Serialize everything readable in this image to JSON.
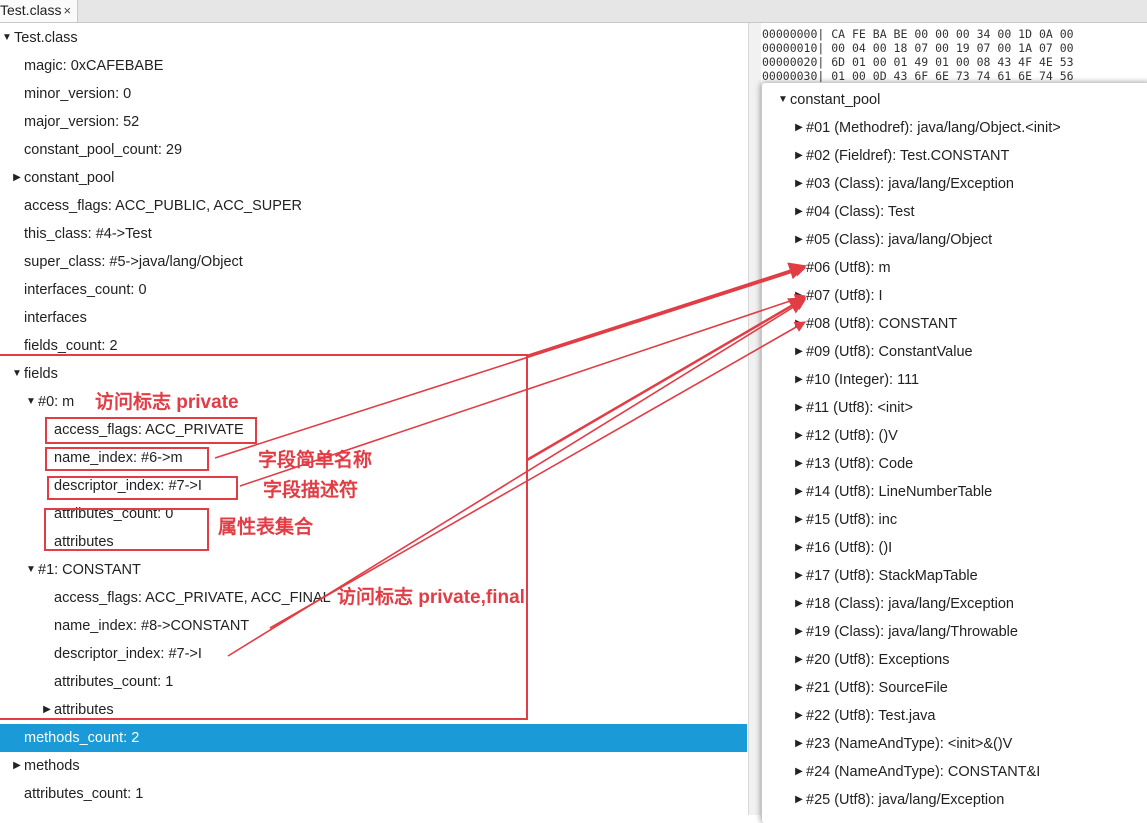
{
  "tab": {
    "label": "Test.class",
    "close": "×"
  },
  "tree": [
    {
      "depth": 0,
      "toggle": "open",
      "text": "Test.class"
    },
    {
      "depth": 1,
      "toggle": "none",
      "text": "magic: 0xCAFEBABE"
    },
    {
      "depth": 1,
      "toggle": "none",
      "text": "minor_version: 0"
    },
    {
      "depth": 1,
      "toggle": "none",
      "text": "major_version: 52"
    },
    {
      "depth": 1,
      "toggle": "none",
      "text": "constant_pool_count: 29"
    },
    {
      "depth": 1,
      "toggle": "closed",
      "text": "constant_pool"
    },
    {
      "depth": 1,
      "toggle": "none",
      "text": "access_flags: ACC_PUBLIC, ACC_SUPER"
    },
    {
      "depth": 1,
      "toggle": "none",
      "text": "this_class: #4->Test"
    },
    {
      "depth": 1,
      "toggle": "none",
      "text": "super_class: #5->java/lang/Object"
    },
    {
      "depth": 1,
      "toggle": "none",
      "text": "interfaces_count: 0"
    },
    {
      "depth": 1,
      "toggle": "none",
      "text": "interfaces"
    },
    {
      "depth": 1,
      "toggle": "none",
      "text": "fields_count: 2"
    },
    {
      "depth": 1,
      "toggle": "open",
      "text": "fields"
    },
    {
      "depth": 2,
      "toggle": "open",
      "text": "#0: m"
    },
    {
      "depth": 3,
      "toggle": "none",
      "text": "access_flags: ACC_PRIVATE"
    },
    {
      "depth": 3,
      "toggle": "none",
      "text": "name_index: #6->m"
    },
    {
      "depth": 3,
      "toggle": "none",
      "text": "descriptor_index: #7->I"
    },
    {
      "depth": 3,
      "toggle": "none",
      "text": "attributes_count: 0"
    },
    {
      "depth": 3,
      "toggle": "none",
      "text": "attributes"
    },
    {
      "depth": 2,
      "toggle": "open",
      "text": "#1: CONSTANT"
    },
    {
      "depth": 3,
      "toggle": "none",
      "text": "access_flags: ACC_PRIVATE, ACC_FINAL"
    },
    {
      "depth": 3,
      "toggle": "none",
      "text": "name_index: #8->CONSTANT"
    },
    {
      "depth": 3,
      "toggle": "none",
      "text": "descriptor_index: #7->I"
    },
    {
      "depth": 3,
      "toggle": "none",
      "text": "attributes_count: 1"
    },
    {
      "depth": 3,
      "toggle": "closed",
      "text": "attributes"
    },
    {
      "depth": 1,
      "toggle": "none",
      "text": "methods_count: 2",
      "selected": true
    },
    {
      "depth": 1,
      "toggle": "closed",
      "text": "methods"
    },
    {
      "depth": 1,
      "toggle": "none",
      "text": "attributes_count: 1"
    }
  ],
  "hex_lines": [
    "00000000| CA FE BA BE 00 00 00 34 00 1D 0A 00",
    "00000010| 00 04 00 18 07 00 19 07 00 1A 07 00",
    "00000020| 6D 01 00 01 49 01 00 08 43 4F 4E 53",
    "00000030| 01 00 0D 43 6F 6E 73 74 61 6E 74 56"
  ],
  "constant_pool": {
    "title": "constant_pool",
    "entries": [
      "#01 (Methodref): java/lang/Object.<init>",
      "#02 (Fieldref): Test.CONSTANT",
      "#03 (Class): java/lang/Exception",
      "#04 (Class): Test",
      "#05 (Class): java/lang/Object",
      "#06 (Utf8): m",
      "#07 (Utf8): I",
      "#08 (Utf8): CONSTANT",
      "#09 (Utf8): ConstantValue",
      "#10 (Integer): 111",
      "#11 (Utf8): <init>",
      "#12 (Utf8): ()V",
      "#13 (Utf8): Code",
      "#14 (Utf8): LineNumberTable",
      "#15 (Utf8): inc",
      "#16 (Utf8): ()I",
      "#17 (Utf8): StackMapTable",
      "#18 (Class): java/lang/Exception",
      "#19 (Class): java/lang/Throwable",
      "#20 (Utf8): Exceptions",
      "#21 (Utf8): SourceFile",
      "#22 (Utf8): Test.java",
      "#23 (NameAndType): <init>&()V",
      "#24 (NameAndType): CONSTANT&I",
      "#25 (Utf8): java/lang/Exception"
    ]
  },
  "annotations": {
    "access_flag_private": "访问标志 private",
    "simple_name": "字段简单名称",
    "descriptor": "字段描述符",
    "attribute_table": "属性表集合",
    "access_flag_private_final": "访问标志 private,final"
  },
  "colors": {
    "annotation": "#e23c45",
    "selection": "#1a9ad6"
  }
}
